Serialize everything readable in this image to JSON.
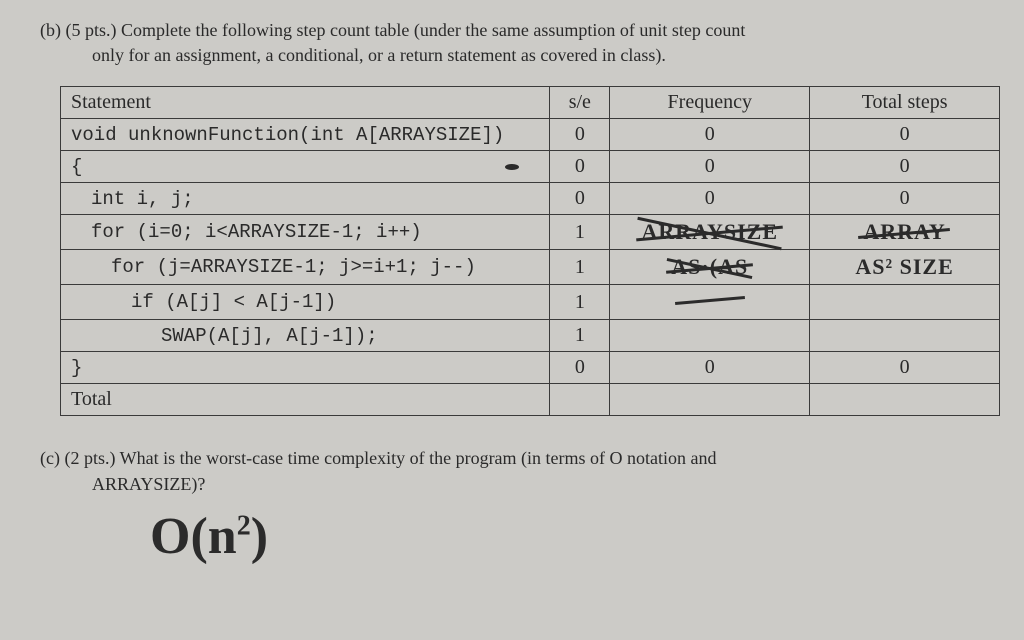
{
  "question_b": {
    "label": "(b) (5 pts.)",
    "text1": "Complete the following step count table (under the same assumption of unit step count",
    "text2": "only for an assignment, a conditional, or a return statement as covered in class)."
  },
  "table": {
    "headers": {
      "stmt": "Statement",
      "se": "s/e",
      "freq": "Frequency",
      "total": "Total steps"
    },
    "rows": [
      {
        "stmt": "void unknownFunction(int A[ARRAYSIZE])",
        "cls": "",
        "se": "0",
        "freq": "0",
        "total": "0"
      },
      {
        "stmt": "{",
        "cls": "",
        "se": "0",
        "freq": "0",
        "total": "0",
        "dot": true
      },
      {
        "stmt": "int i, j;",
        "cls": "pad1",
        "se": "0",
        "freq": "0",
        "total": "0"
      },
      {
        "stmt": "for (i=0; i<ARRAYSIZE-1; i++)",
        "cls": "pad1",
        "se": "1",
        "freq_hw": "ARRAYSIZE",
        "total_hw": "ARRAY",
        "strike_freq": true,
        "strike_total": true
      },
      {
        "stmt": "for (j=ARRAYSIZE-1; j>=i+1; j--)",
        "cls": "pad2",
        "se": "1",
        "freq_hw": "AS·(AS",
        "total_hw": "AS² SIZE",
        "strike_freq": true
      },
      {
        "stmt": "if (A[j] < A[j-1])",
        "cls": "pad3",
        "se": "1",
        "freq_hw": "",
        "total_hw": ""
      },
      {
        "stmt": "SWAP(A[j], A[j-1]);",
        "cls": "pad4",
        "se": "1",
        "freq_hw": "",
        "total_hw": ""
      },
      {
        "stmt": "}",
        "cls": "",
        "se": "0",
        "freq": "0",
        "total": "0"
      }
    ],
    "total_label": "Total"
  },
  "question_c": {
    "label": "(c) (2 pts.)",
    "text1": "What is the worst-case time complexity of the program (in terms of O notation and",
    "text2": "ARRAYSIZE)?"
  },
  "answer_c": "O(n²)"
}
